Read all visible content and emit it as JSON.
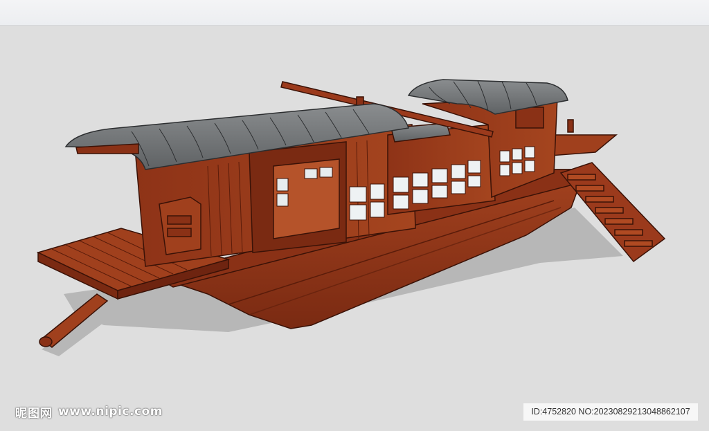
{
  "watermark": {
    "brand": "昵图网",
    "url": "www.nipic.com",
    "id_text": "ID:4752820 NO:20230829213048862107"
  },
  "colors": {
    "background": "#dedede",
    "wood": "#9b3a1c",
    "wood_dark": "#6e2410",
    "roof": "#7b7e80",
    "shadow": "#b4b4b4"
  },
  "image_subject": {
    "icon": "wooden-boat-model"
  }
}
